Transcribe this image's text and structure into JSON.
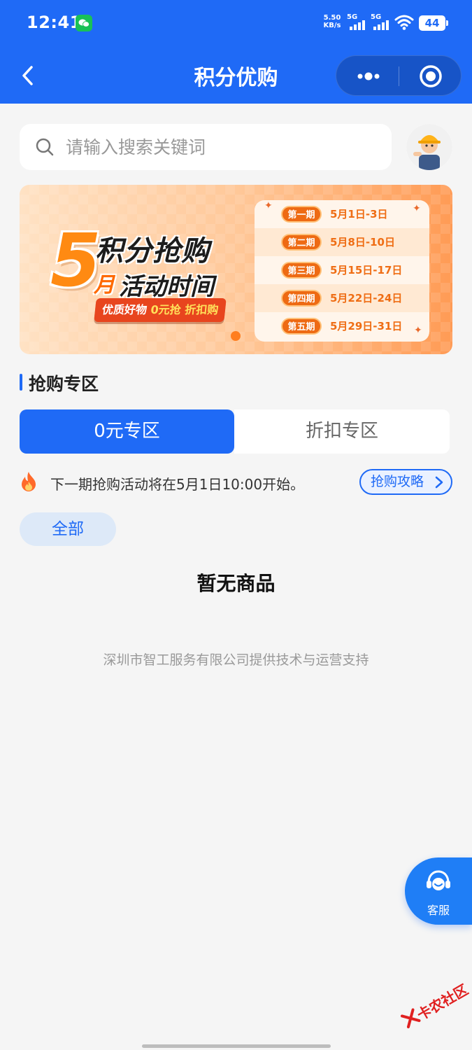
{
  "status_bar": {
    "time": "12:41",
    "net_speed_value": "5.50",
    "net_speed_unit": "KB/s",
    "signal1_label": "5G",
    "signal2_label": "5G",
    "battery": "44",
    "icons": [
      "wechat-icon",
      "signal-icon",
      "wifi-icon",
      "battery-icon"
    ]
  },
  "nav": {
    "title": "积分优购",
    "icons": [
      "back-icon",
      "more-icon",
      "target-icon"
    ]
  },
  "search": {
    "placeholder": "请输入搜索关键词"
  },
  "banner": {
    "big_number": "5",
    "month_char": "月",
    "title_line1": "积分抢购",
    "title_line2": "活动时间",
    "tagline_part1": "优质好物 ",
    "tagline_highlight1": "0元抢",
    "tagline_part2": " ",
    "tagline_highlight2": "折扣购",
    "schedule": [
      {
        "period": "第一期",
        "dates": "5月1日-3日"
      },
      {
        "period": "第二期",
        "dates": "5月8日-10日"
      },
      {
        "period": "第三期",
        "dates": "5月15日-17日"
      },
      {
        "period": "第四期",
        "dates": "5月22日-24日"
      },
      {
        "period": "第五期",
        "dates": "5月29日-31日"
      }
    ]
  },
  "section": {
    "title": "抢购专区"
  },
  "tabs": {
    "active": "0元专区",
    "inactive": "折扣专区"
  },
  "notice": {
    "text": "下一期抢购活动将在5月1日10:00开始。",
    "guide_button": "抢购攻略"
  },
  "category": {
    "all": "全部"
  },
  "empty_state": "暂无商品",
  "footer": "深圳市智工服务有限公司提供技术与运营支持",
  "customer_service": {
    "label": "客服"
  },
  "watermark": "卡农社区",
  "colors": {
    "primary": "#1f6af6",
    "background": "#f5f5f5",
    "banner_orange": "#ff8a12"
  }
}
